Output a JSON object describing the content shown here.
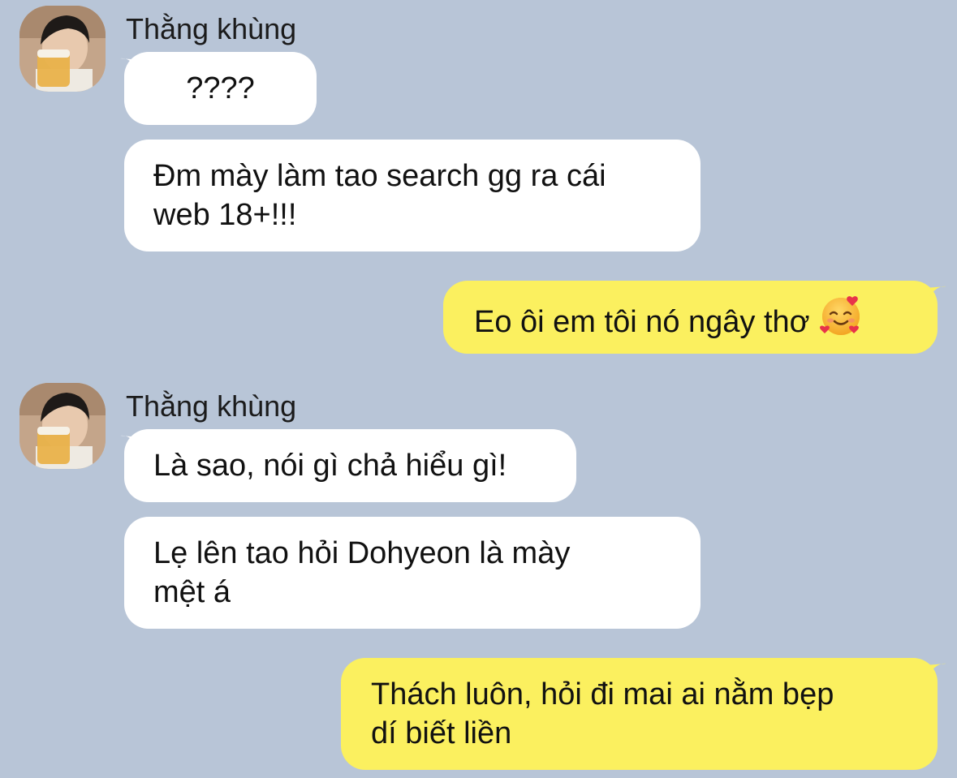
{
  "colors": {
    "background": "#b8c5d7",
    "incoming_bubble": "#ffffff",
    "outgoing_bubble": "#fbf05f"
  },
  "groups": [
    {
      "sender": "Thằng khùng",
      "avatar_icon": "user-avatar-photo",
      "messages": [
        "????",
        "Đm mày làm tao search gg ra cái\nweb 18+!!!"
      ]
    },
    {
      "outgoing": [
        "Eo ôi em tôi nó ngây thơ"
      ],
      "emoji": "smiling-face-with-hearts-icon"
    },
    {
      "sender": "Thằng khùng",
      "avatar_icon": "user-avatar-photo",
      "messages": [
        "Là sao, nói gì chả hiểu gì!",
        "Lẹ lên tao hỏi Dohyeon là mày\nmệt á"
      ]
    },
    {
      "outgoing": [
        "Thách luôn, hỏi đi mai ai nằm bẹp\ndí biết liền"
      ]
    }
  ]
}
